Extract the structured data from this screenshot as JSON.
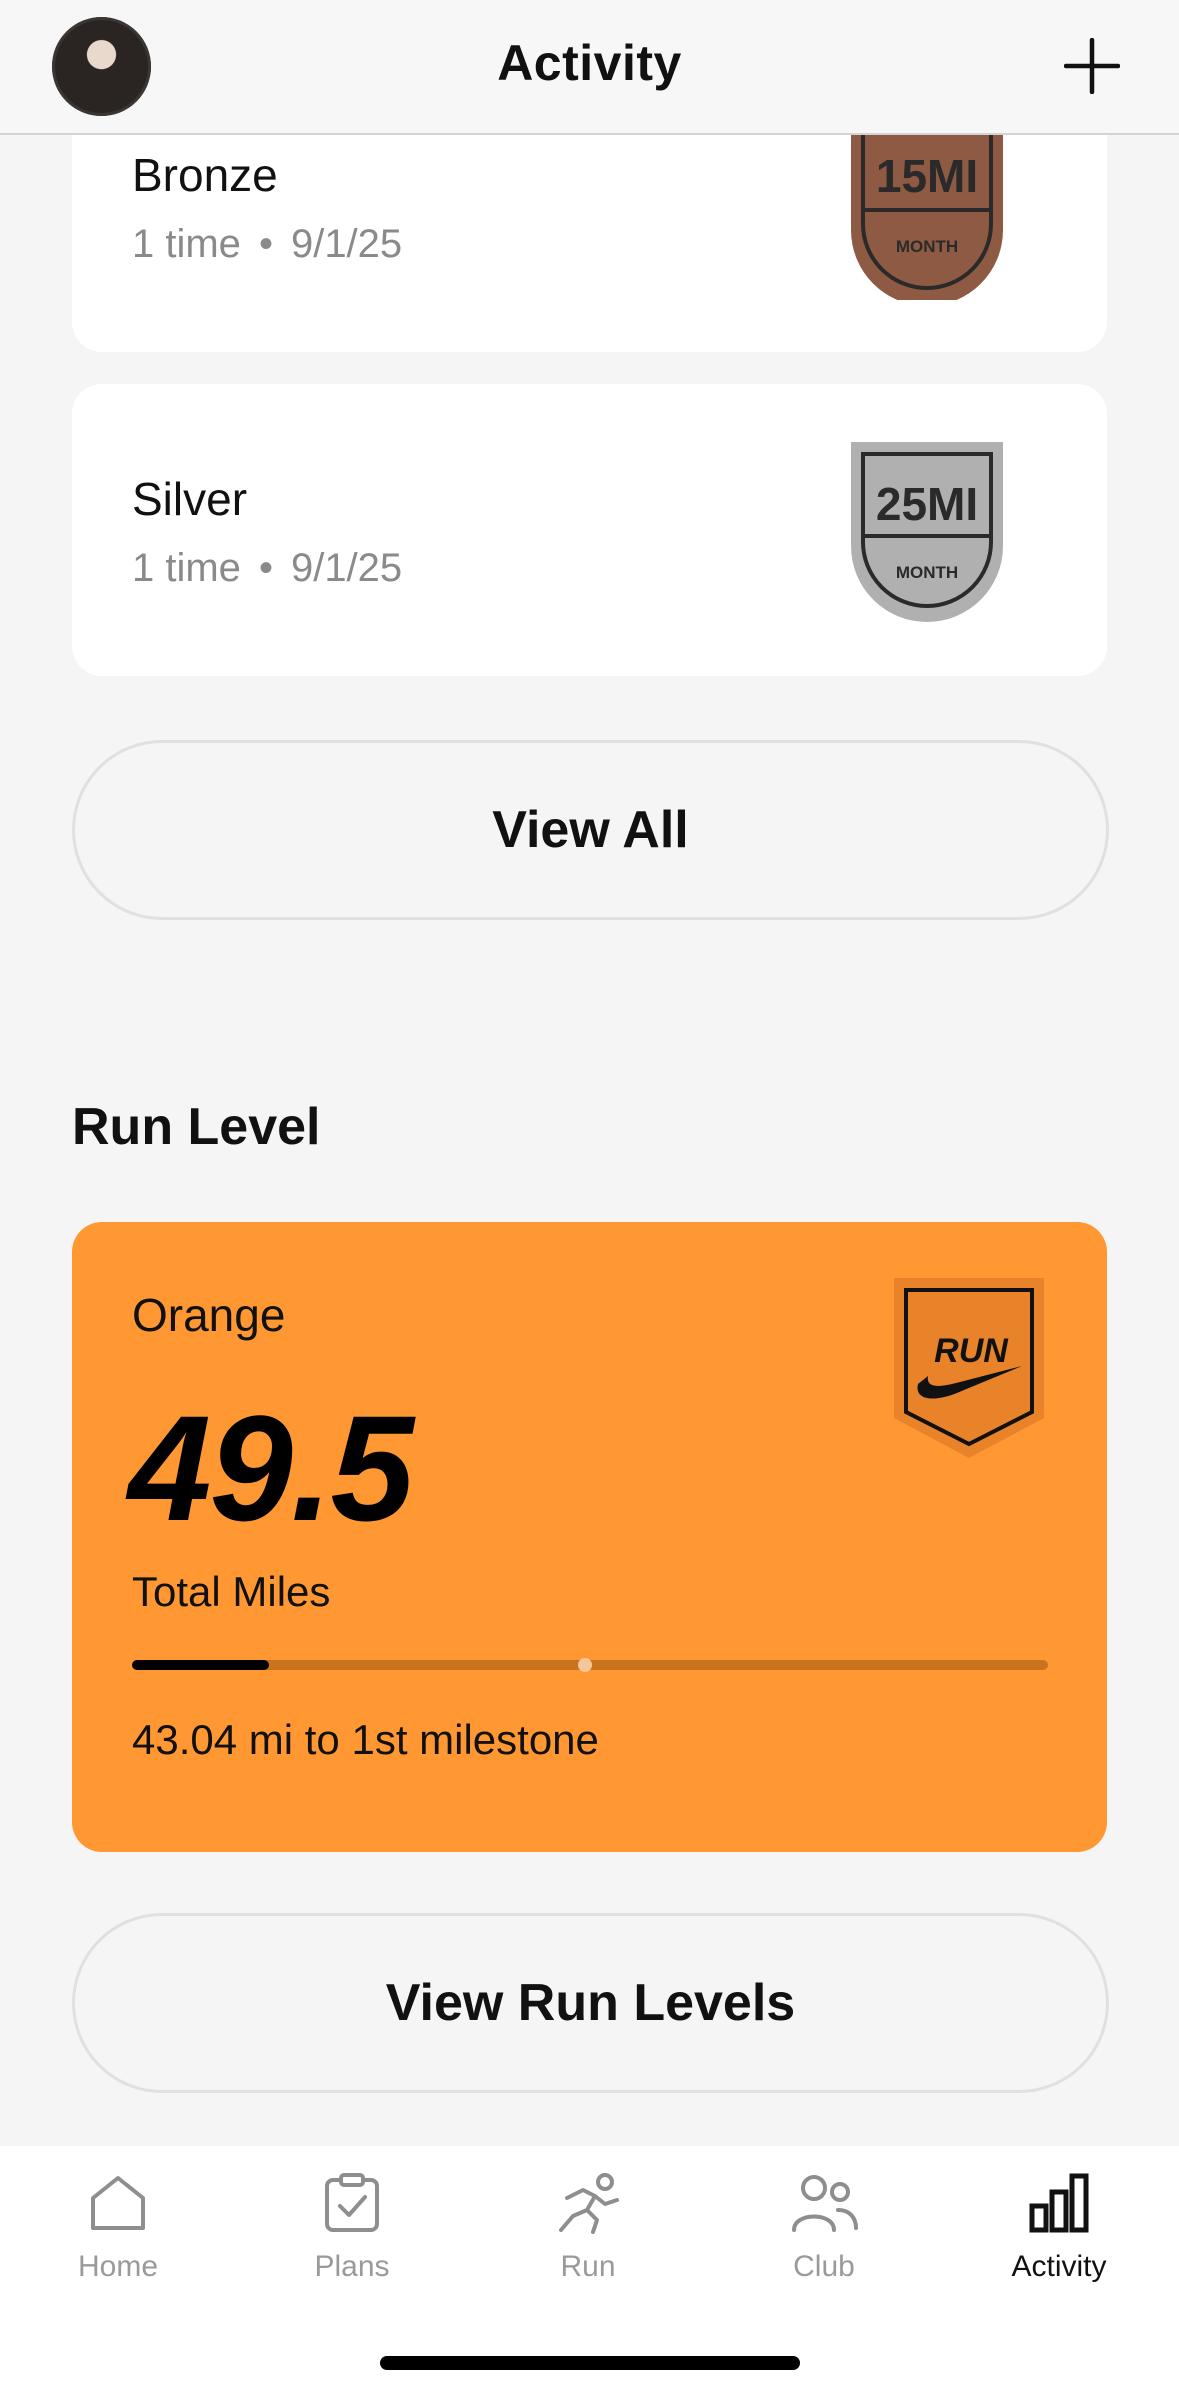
{
  "header": {
    "title": "Activity",
    "add_icon": "plus-icon",
    "avatar": "profile-avatar"
  },
  "achievements": [
    {
      "name": "Bronze",
      "count": "1 time",
      "date": "9/1/25",
      "badge_value": "15MI",
      "badge_period": "MONTH",
      "badge_color": "#8e5a43"
    },
    {
      "name": "Silver",
      "count": "1 time",
      "date": "9/1/25",
      "badge_value": "25MI",
      "badge_period": "MONTH",
      "badge_color": "#b0b0b0"
    }
  ],
  "separator": "•",
  "view_all_label": "View All",
  "run_level": {
    "section_title": "Run Level",
    "level_name": "Orange",
    "total_miles": "49.5",
    "total_miles_label": "Total Miles",
    "progress_fraction": 0.15,
    "remaining_text": "43.04 mi to 1st milestone",
    "badge_text": "RUN",
    "card_color": "#ff9733"
  },
  "view_run_levels_label": "View Run Levels",
  "tabs": [
    {
      "label": "Home",
      "icon": "home-icon",
      "active": false
    },
    {
      "label": "Plans",
      "icon": "clipboard-check-icon",
      "active": false
    },
    {
      "label": "Run",
      "icon": "runner-icon",
      "active": false
    },
    {
      "label": "Club",
      "icon": "people-icon",
      "active": false
    },
    {
      "label": "Activity",
      "icon": "bar-chart-icon",
      "active": true
    }
  ]
}
